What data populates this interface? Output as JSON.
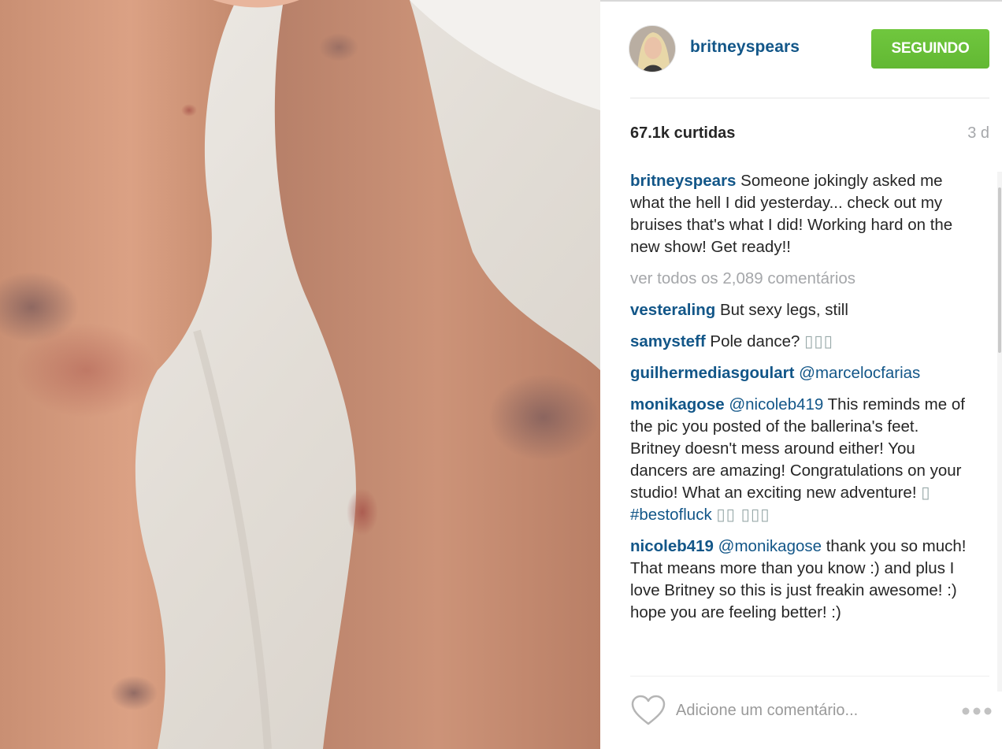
{
  "post": {
    "username": "britneyspears",
    "follow_label": "SEGUINDO",
    "likes": "67.1k curtidas",
    "time": "3 d",
    "caption": {
      "user": "britneyspears",
      "text": "Someone jokingly asked me what the hell I did yesterday... check out my bruises that's what I did! Working hard on the new show! Get ready!!"
    },
    "view_all": "ver todos os 2,089 comentários",
    "comments": [
      {
        "user": "vesteraling",
        "text": "But sexy legs, still"
      },
      {
        "user": "samysteff",
        "text": "Pole dance? ",
        "emoji": "▯▯▯"
      },
      {
        "user": "guilhermediasgoulart",
        "mention": "@marcelocfarias"
      },
      {
        "user": "monikagose",
        "mention": "@nicoleb419",
        "text": "This reminds me of the pic you posted of the ballerina's feet. Britney doesn't mess around either! You dancers are amazing! Congratulations on your studio! What an exciting new adventure! ",
        "emoji1": "▯",
        "hashtag": "#bestofluck",
        "emoji2": "▯▯ ▯▯▯"
      },
      {
        "user": "nicoleb419",
        "mention": "@monikagose",
        "text": "thank you so much! That means more than you know :) and plus I love Britney so this is just freakin awesome! :) hope you are feeling better! :)"
      }
    ],
    "comment_placeholder": "Adicione um comentário...",
    "icons": {
      "like": "heart-icon",
      "options": "more-options-icon"
    }
  },
  "colors": {
    "link": "#125688",
    "follow_button": "#6ac338",
    "muted": "#a5a7aa"
  }
}
